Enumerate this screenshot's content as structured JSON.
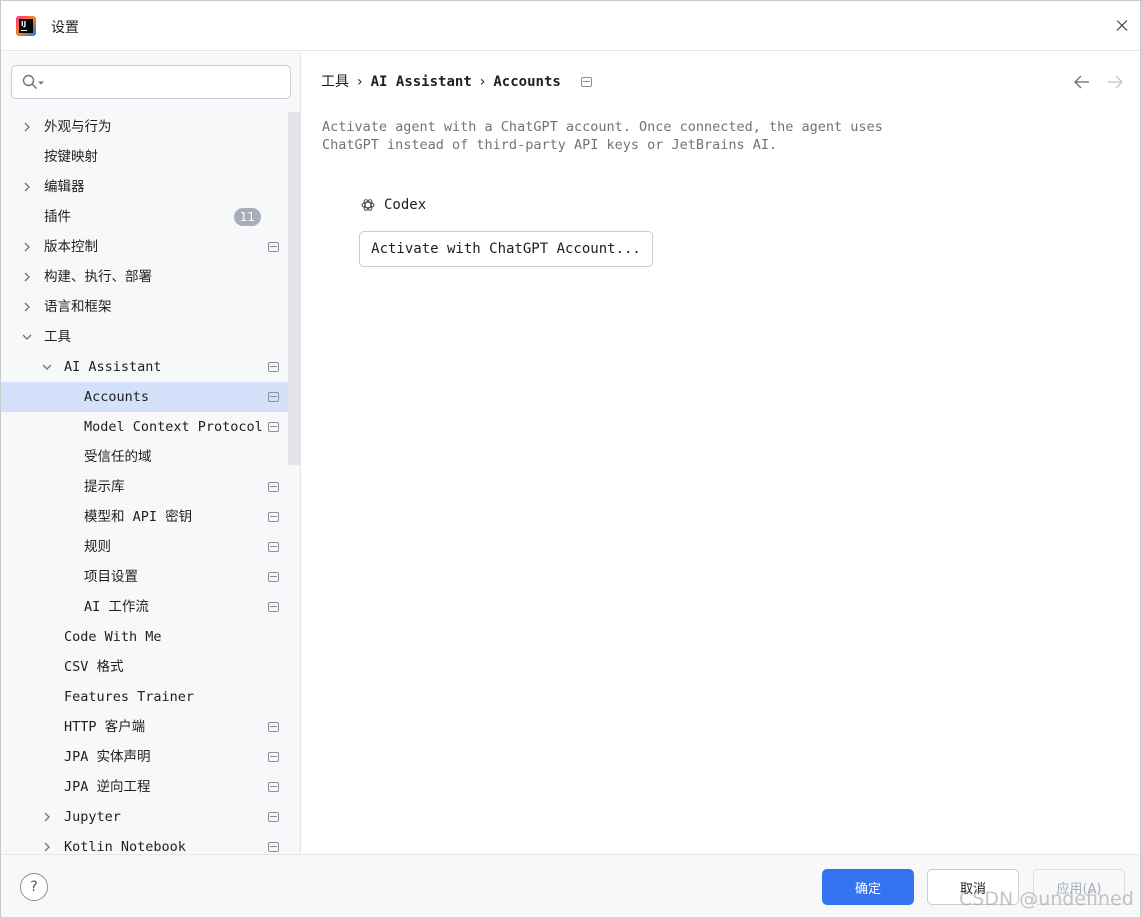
{
  "window": {
    "title": "设置"
  },
  "search": {
    "placeholder": "",
    "value": ""
  },
  "sidebar": {
    "items": [
      {
        "label": "外观与行为",
        "level": 0,
        "expandable": true,
        "expanded": false,
        "page_icon": false
      },
      {
        "label": "按键映射",
        "level": 0,
        "expandable": false,
        "page_icon": false
      },
      {
        "label": "编辑器",
        "level": 0,
        "expandable": true,
        "expanded": false,
        "page_icon": false
      },
      {
        "label": "插件",
        "level": 0,
        "expandable": false,
        "page_icon": false,
        "badge": "11"
      },
      {
        "label": "版本控制",
        "level": 0,
        "expandable": true,
        "expanded": false,
        "page_icon": true
      },
      {
        "label": "构建、执行、部署",
        "level": 0,
        "expandable": true,
        "expanded": false,
        "page_icon": false
      },
      {
        "label": "语言和框架",
        "level": 0,
        "expandable": true,
        "expanded": false,
        "page_icon": false
      },
      {
        "label": "工具",
        "level": 0,
        "expandable": true,
        "expanded": true,
        "page_icon": false
      },
      {
        "label": "AI Assistant",
        "level": 1,
        "expandable": true,
        "expanded": true,
        "page_icon": true
      },
      {
        "label": "Accounts",
        "level": 2,
        "expandable": false,
        "page_icon": true,
        "selected": true
      },
      {
        "label": "Model Context Protocol",
        "level": 2,
        "expandable": false,
        "page_icon": true
      },
      {
        "label": "受信任的域",
        "level": 2,
        "expandable": false,
        "page_icon": false
      },
      {
        "label": "提示库",
        "level": 2,
        "expandable": false,
        "page_icon": true
      },
      {
        "label": "模型和 API 密钥",
        "level": 2,
        "expandable": false,
        "page_icon": true
      },
      {
        "label": "规则",
        "level": 2,
        "expandable": false,
        "page_icon": true
      },
      {
        "label": "项目设置",
        "level": 2,
        "expandable": false,
        "page_icon": true
      },
      {
        "label": "AI 工作流",
        "level": 2,
        "expandable": false,
        "page_icon": true
      },
      {
        "label": "Code With Me",
        "level": 1,
        "expandable": false,
        "page_icon": false
      },
      {
        "label": "CSV 格式",
        "level": 1,
        "expandable": false,
        "page_icon": false
      },
      {
        "label": "Features Trainer",
        "level": 1,
        "expandable": false,
        "page_icon": false
      },
      {
        "label": "HTTP 客户端",
        "level": 1,
        "expandable": false,
        "page_icon": true
      },
      {
        "label": "JPA 实体声明",
        "level": 1,
        "expandable": false,
        "page_icon": true
      },
      {
        "label": "JPA 逆向工程",
        "level": 1,
        "expandable": false,
        "page_icon": true
      },
      {
        "label": "Jupyter",
        "level": 1,
        "expandable": true,
        "expanded": false,
        "page_icon": true
      },
      {
        "label": "Kotlin Notebook",
        "level": 1,
        "expandable": true,
        "expanded": false,
        "page_icon": true
      }
    ]
  },
  "main": {
    "breadcrumb": {
      "root": "工具",
      "parent": "AI Assistant",
      "current": "Accounts",
      "separator": "›"
    },
    "description": "Activate agent with a ChatGPT account. Once connected, the agent uses ChatGPT instead of third-party API keys or JetBrains AI.",
    "codex_label": "Codex",
    "activate_button": "Activate with ChatGPT Account..."
  },
  "footer": {
    "help_label": "?",
    "ok_label": "确定",
    "cancel_label": "取消",
    "apply_label": "应用(A)"
  },
  "watermark": "CSDN @undefined",
  "colors": {
    "accent": "#3574f0",
    "selected_row": "#d5e1fb",
    "sidebar_bg": "#f7f8fa",
    "muted_text": "#6f737a",
    "badge_bg": "#a8adb8"
  }
}
